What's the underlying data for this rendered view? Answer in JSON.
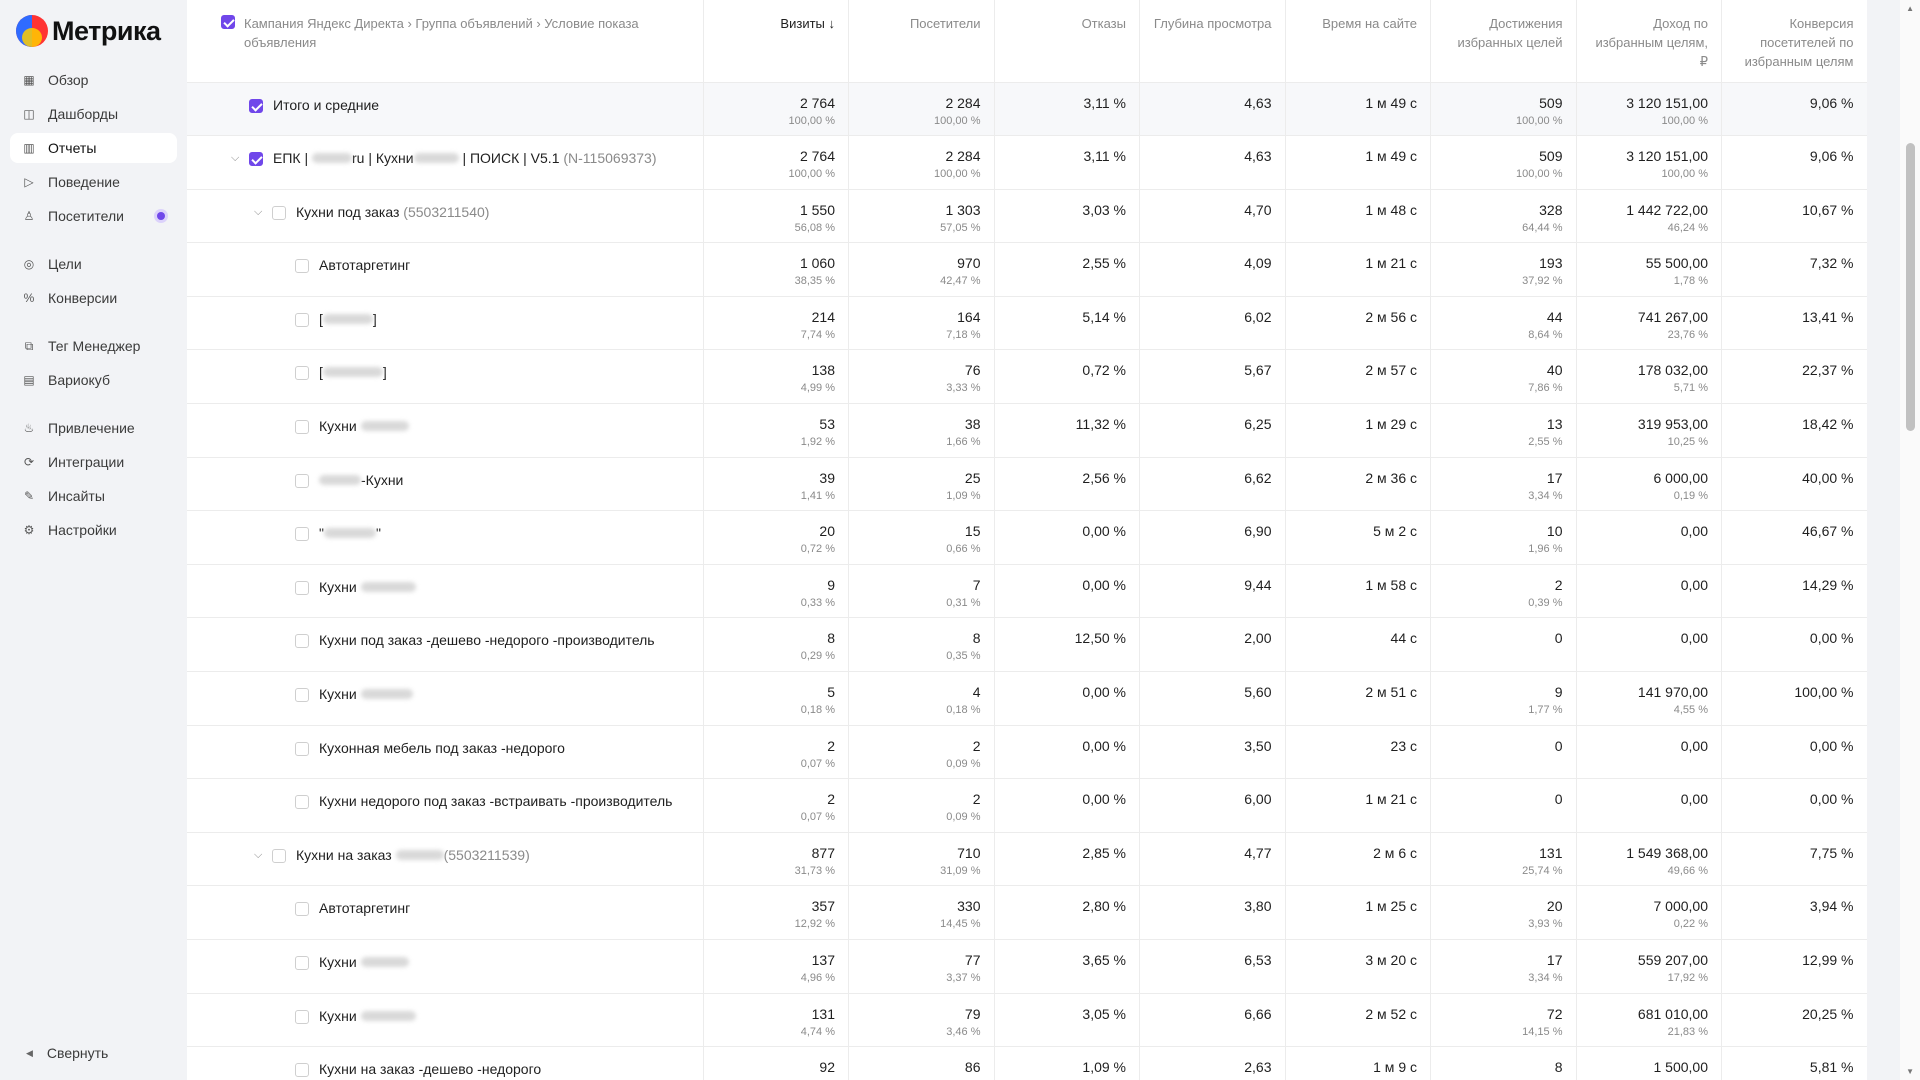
{
  "app": {
    "title": "Метрика"
  },
  "nav": {
    "items": [
      {
        "label": "Обзор",
        "icon": "grid-icon"
      },
      {
        "label": "Дашборды",
        "icon": "dashboard-icon"
      },
      {
        "label": "Отчеты",
        "icon": "bar-chart-icon"
      },
      {
        "label": "Поведение",
        "icon": "play-icon"
      },
      {
        "label": "Посетители",
        "icon": "person-icon"
      },
      {
        "label": "Цели",
        "icon": "target-icon"
      },
      {
        "label": "Конверсии",
        "icon": "percent-icon"
      },
      {
        "label": "Тег Менеджер",
        "icon": "tag-icon"
      },
      {
        "label": "Вариокуб",
        "icon": "cube-icon"
      },
      {
        "label": "Привлечение",
        "icon": "flame-icon"
      },
      {
        "label": "Интеграции",
        "icon": "link-icon"
      },
      {
        "label": "Инсайты",
        "icon": "insight-icon"
      },
      {
        "label": "Настройки",
        "icon": "gear-icon"
      }
    ],
    "collapse_label": "Свернуть"
  },
  "table": {
    "headers": [
      "Кампания Яндекс Директа › Группа объявлений › Условие показа объявления",
      "Визиты ↓",
      "Посетители",
      "Отказы",
      "Глубина просмотра",
      "Время на сайте",
      "Достижения избранных целей",
      "Доход по избранным целям, ₽",
      "Конверсия посетителей по избранным целям"
    ],
    "accent_color": "#7047ea",
    "rows": [
      {
        "name": "Итого и средние",
        "visits": "2 764",
        "visits_pct": "100,00 %",
        "visitors": "2 284",
        "visitors_pct": "100,00 %",
        "bounce": "3,11 %",
        "depth": "4,63",
        "time": "1 м 49 с",
        "goals": "509",
        "goals_pct": "100,00 %",
        "revenue": "3 120 151,00",
        "revenue_pct": "100,00 %",
        "conv": "9,06 %"
      },
      {
        "name_a": "ЕПК | ",
        "name_b": "ru | Кухни",
        "name_c": " | ПОИСК | V5.1 ",
        "name_id": "(N-115069373)",
        "visits": "2 764",
        "visits_pct": "100,00 %",
        "visitors": "2 284",
        "visitors_pct": "100,00 %",
        "bounce": "3,11 %",
        "depth": "4,63",
        "time": "1 м 49 с",
        "goals": "509",
        "goals_pct": "100,00 %",
        "revenue": "3 120 151,00",
        "revenue_pct": "100,00 %",
        "conv": "9,06 %"
      },
      {
        "name": "Кухни под заказ ",
        "name_id": "(5503211540)",
        "visits": "1 550",
        "visits_pct": "56,08 %",
        "visitors": "1 303",
        "visitors_pct": "57,05 %",
        "bounce": "3,03 %",
        "depth": "4,70",
        "time": "1 м 48 с",
        "goals": "328",
        "goals_pct": "64,44 %",
        "revenue": "1 442 722,00",
        "revenue_pct": "46,24 %",
        "conv": "10,67 %"
      },
      {
        "name": "Автотаргетинг",
        "visits": "1 060",
        "visits_pct": "38,35 %",
        "visitors": "970",
        "visitors_pct": "42,47 %",
        "bounce": "2,55 %",
        "depth": "4,09",
        "time": "1 м 21 с",
        "goals": "193",
        "goals_pct": "37,92 %",
        "revenue": "55 500,00",
        "revenue_pct": "1,78 %",
        "conv": "7,32 %"
      },
      {
        "name_a": "[",
        "name_c": "]",
        "visits": "214",
        "visits_pct": "7,74 %",
        "visitors": "164",
        "visitors_pct": "7,18 %",
        "bounce": "5,14 %",
        "depth": "6,02",
        "time": "2 м 56 с",
        "goals": "44",
        "goals_pct": "8,64 %",
        "revenue": "741 267,00",
        "revenue_pct": "23,76 %",
        "conv": "13,41 %"
      },
      {
        "name_a": "[",
        "name_c": "]",
        "visits": "138",
        "visits_pct": "4,99 %",
        "visitors": "76",
        "visitors_pct": "3,33 %",
        "bounce": "0,72 %",
        "depth": "5,67",
        "time": "2 м 57 с",
        "goals": "40",
        "goals_pct": "7,86 %",
        "revenue": "178 032,00",
        "revenue_pct": "5,71 %",
        "conv": "22,37 %"
      },
      {
        "name_a": "Кухни ",
        "visits": "53",
        "visits_pct": "1,92 %",
        "visitors": "38",
        "visitors_pct": "1,66 %",
        "bounce": "11,32 %",
        "depth": "6,25",
        "time": "1 м 29 с",
        "goals": "13",
        "goals_pct": "2,55 %",
        "revenue": "319 953,00",
        "revenue_pct": "10,25 %",
        "conv": "18,42 %"
      },
      {
        "name_c": "-Кухни",
        "visits": "39",
        "visits_pct": "1,41 %",
        "visitors": "25",
        "visitors_pct": "1,09 %",
        "bounce": "2,56 %",
        "depth": "6,62",
        "time": "2 м 36 с",
        "goals": "17",
        "goals_pct": "3,34 %",
        "revenue": "6 000,00",
        "revenue_pct": "0,19 %",
        "conv": "40,00 %"
      },
      {
        "name_a": "\"",
        "name_c": "\"",
        "visits": "20",
        "visits_pct": "0,72 %",
        "visitors": "15",
        "visitors_pct": "0,66 %",
        "bounce": "0,00 %",
        "depth": "6,90",
        "time": "5 м 2 с",
        "goals": "10",
        "goals_pct": "1,96 %",
        "revenue": "0,00",
        "revenue_pct": "",
        "conv": "46,67 %"
      },
      {
        "name_a": "Кухни ",
        "visits": "9",
        "visits_pct": "0,33 %",
        "visitors": "7",
        "visitors_pct": "0,31 %",
        "bounce": "0,00 %",
        "depth": "9,44",
        "time": "1 м 58 с",
        "goals": "2",
        "goals_pct": "0,39 %",
        "revenue": "0,00",
        "revenue_pct": "",
        "conv": "14,29 %"
      },
      {
        "name": "Кухни под заказ -дешево -недорого -производитель",
        "visits": "8",
        "visits_pct": "0,29 %",
        "visitors": "8",
        "visitors_pct": "0,35 %",
        "bounce": "12,50 %",
        "depth": "2,00",
        "time": "44 с",
        "goals": "0",
        "goals_pct": "",
        "revenue": "0,00",
        "revenue_pct": "",
        "conv": "0,00 %"
      },
      {
        "name_a": "Кухни ",
        "visits": "5",
        "visits_pct": "0,18 %",
        "visitors": "4",
        "visitors_pct": "0,18 %",
        "bounce": "0,00 %",
        "depth": "5,60",
        "time": "2 м 51 с",
        "goals": "9",
        "goals_pct": "1,77 %",
        "revenue": "141 970,00",
        "revenue_pct": "4,55 %",
        "conv": "100,00 %"
      },
      {
        "name": "Кухонная мебель под заказ -недорого",
        "visits": "2",
        "visits_pct": "0,07 %",
        "visitors": "2",
        "visitors_pct": "0,09 %",
        "bounce": "0,00 %",
        "depth": "3,50",
        "time": "23 с",
        "goals": "0",
        "goals_pct": "",
        "revenue": "0,00",
        "revenue_pct": "",
        "conv": "0,00 %"
      },
      {
        "name": "Кухни недорого под заказ -встраивать -производитель",
        "visits": "2",
        "visits_pct": "0,07 %",
        "visitors": "2",
        "visitors_pct": "0,09 %",
        "bounce": "0,00 %",
        "depth": "6,00",
        "time": "1 м 21 с",
        "goals": "0",
        "goals_pct": "",
        "revenue": "0,00",
        "revenue_pct": "",
        "conv": "0,00 %"
      },
      {
        "name_a": "Кухни на заказ ",
        "name_id": "(5503211539)",
        "visits": "877",
        "visits_pct": "31,73 %",
        "visitors": "710",
        "visitors_pct": "31,09 %",
        "bounce": "2,85 %",
        "depth": "4,77",
        "time": "2 м 6 с",
        "goals": "131",
        "goals_pct": "25,74 %",
        "revenue": "1 549 368,00",
        "revenue_pct": "49,66 %",
        "conv": "7,75 %"
      },
      {
        "name": "Автотаргетинг",
        "visits": "357",
        "visits_pct": "12,92 %",
        "visitors": "330",
        "visitors_pct": "14,45 %",
        "bounce": "2,80 %",
        "depth": "3,80",
        "time": "1 м 25 с",
        "goals": "20",
        "goals_pct": "3,93 %",
        "revenue": "7 000,00",
        "revenue_pct": "0,22 %",
        "conv": "3,94 %"
      },
      {
        "name_a": "Кухни ",
        "visits": "137",
        "visits_pct": "4,96 %",
        "visitors": "77",
        "visitors_pct": "3,37 %",
        "bounce": "3,65 %",
        "depth": "6,53",
        "time": "3 м 20 с",
        "goals": "17",
        "goals_pct": "3,34 %",
        "revenue": "559 207,00",
        "revenue_pct": "17,92 %",
        "conv": "12,99 %"
      },
      {
        "name_a": "Кухни ",
        "visits": "131",
        "visits_pct": "4,74 %",
        "visitors": "79",
        "visitors_pct": "3,46 %",
        "bounce": "3,05 %",
        "depth": "6,66",
        "time": "2 м 52 с",
        "goals": "72",
        "goals_pct": "14,15 %",
        "revenue": "681 010,00",
        "revenue_pct": "21,83 %",
        "conv": "20,25 %"
      },
      {
        "name": "Кухни на заказ -дешево -недорого",
        "visits": "92",
        "visits_pct": "",
        "visitors": "86",
        "visitors_pct": "",
        "bounce": "1,09 %",
        "depth": "2,63",
        "time": "1 м 9 с",
        "goals": "8",
        "goals_pct": "",
        "revenue": "1 500,00",
        "revenue_pct": "",
        "conv": "5,81 %"
      }
    ]
  }
}
